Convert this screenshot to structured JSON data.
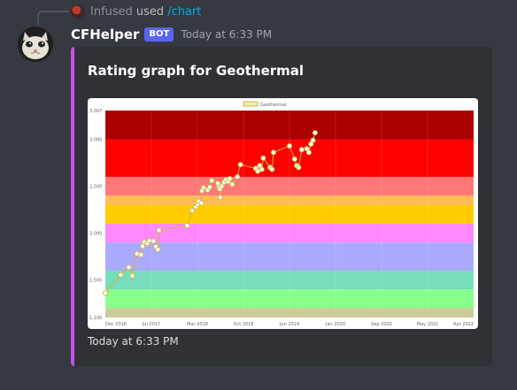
{
  "reply": {
    "username": "Infused",
    "used_text": "used",
    "command": "/chart"
  },
  "message": {
    "username": "CFHelper",
    "bot_tag": "BOT",
    "timestamp": "Today at 6:33 PM"
  },
  "embed": {
    "title": "Rating graph for Geothermal",
    "footer": "Today at 6:33 PM",
    "accent_color": "#c253e8"
  },
  "chart_data": {
    "type": "line",
    "legend": [
      "Geothermal"
    ],
    "legend_position": "top",
    "x_ticks": [
      "Dec 2016",
      "Jul 2017",
      "Mar 2018",
      "Oct 2018",
      "Jun 2019",
      "Jan 2020",
      "Sep 2020",
      "May 2021",
      "Apr 2022"
    ],
    "y_ticks": [
      1100,
      1500,
      2000,
      2500,
      3000,
      3307
    ],
    "ylim": [
      1100,
      3307
    ],
    "xlim": [
      0,
      18
    ],
    "rating_bands": [
      {
        "from": 1100,
        "to": 1200,
        "color": "#cccc99"
      },
      {
        "from": 1200,
        "to": 1400,
        "color": "#88ff88"
      },
      {
        "from": 1400,
        "to": 1600,
        "color": "#77ddbb"
      },
      {
        "from": 1600,
        "to": 1900,
        "color": "#aaaaff"
      },
      {
        "from": 1900,
        "to": 2100,
        "color": "#ff88ff"
      },
      {
        "from": 2100,
        "to": 2300,
        "color": "#ffcc00"
      },
      {
        "from": 2300,
        "to": 2400,
        "color": "#ffbb55"
      },
      {
        "from": 2400,
        "to": 2600,
        "color": "#ff7777"
      },
      {
        "from": 2600,
        "to": 3000,
        "color": "#ff0000"
      },
      {
        "from": 3000,
        "to": 3307,
        "color": "#aa0000"
      }
    ],
    "line_color": "#cfb53b",
    "series": [
      {
        "name": "Geothermal",
        "points": [
          [
            0.0,
            1360
          ],
          [
            0.75,
            1555
          ],
          [
            1.15,
            1635
          ],
          [
            1.32,
            1545
          ],
          [
            1.55,
            1780
          ],
          [
            1.75,
            1770
          ],
          [
            1.82,
            1860
          ],
          [
            1.9,
            1905
          ],
          [
            2.05,
            1890
          ],
          [
            2.15,
            1920
          ],
          [
            2.35,
            1915
          ],
          [
            2.47,
            1855
          ],
          [
            2.57,
            1825
          ],
          [
            2.62,
            2030
          ],
          [
            4.0,
            2080
          ],
          [
            4.25,
            2240
          ],
          [
            4.42,
            2280
          ],
          [
            4.52,
            2310
          ],
          [
            4.57,
            2340
          ],
          [
            4.7,
            2320
          ],
          [
            4.72,
            2450
          ],
          [
            4.8,
            2485
          ],
          [
            5.0,
            2460
          ],
          [
            5.1,
            2490
          ],
          [
            5.2,
            2560
          ],
          [
            5.5,
            2530
          ],
          [
            5.55,
            2490
          ],
          [
            5.6,
            2470
          ],
          [
            5.62,
            2380
          ],
          [
            5.68,
            2500
          ],
          [
            5.8,
            2540
          ],
          [
            5.9,
            2570
          ],
          [
            6.0,
            2550
          ],
          [
            6.08,
            2580
          ],
          [
            6.2,
            2520
          ],
          [
            6.45,
            2600
          ],
          [
            6.6,
            2730
          ],
          [
            7.35,
            2690
          ],
          [
            7.45,
            2660
          ],
          [
            7.55,
            2720
          ],
          [
            7.65,
            2680
          ],
          [
            7.72,
            2800
          ],
          [
            8.05,
            2700
          ],
          [
            8.15,
            2680
          ],
          [
            8.22,
            2860
          ],
          [
            9.0,
            2930
          ],
          [
            9.25,
            2790
          ],
          [
            9.35,
            2720
          ],
          [
            9.45,
            2700
          ],
          [
            9.6,
            2890
          ],
          [
            9.85,
            2900
          ],
          [
            9.95,
            2860
          ],
          [
            10.05,
            2950
          ],
          [
            10.15,
            2990
          ],
          [
            10.25,
            3070
          ]
        ]
      }
    ]
  }
}
